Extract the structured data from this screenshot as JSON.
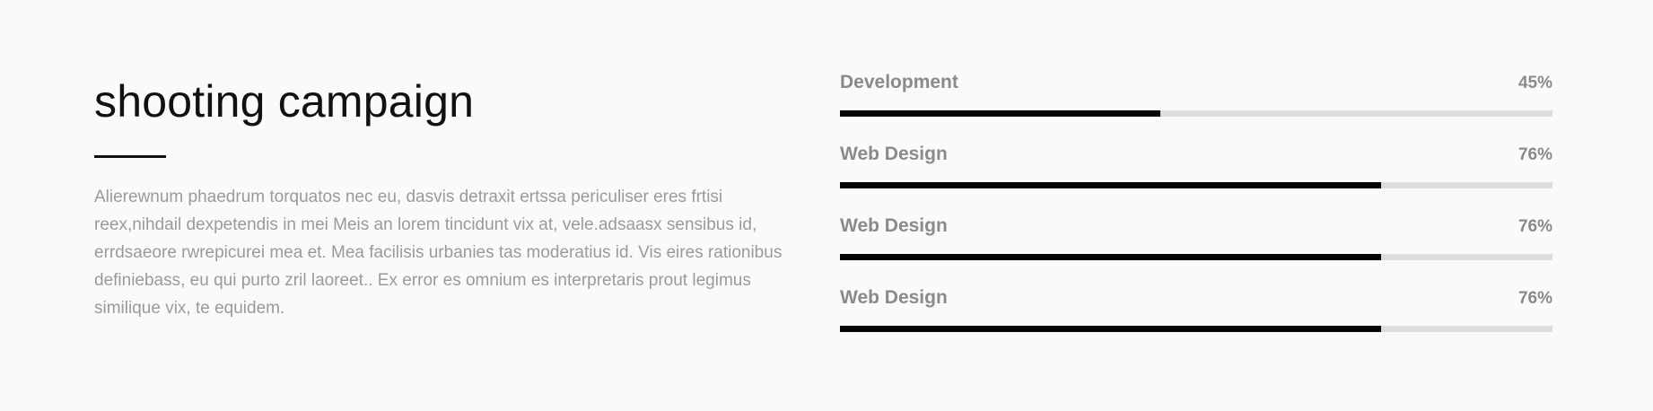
{
  "intro": {
    "title": "shooting campaign",
    "body": "Alierewnum phaedrum torquatos nec eu, dasvis detraxit ertssa periculiser eres frtisi reex,nihdail dexpetendis in mei Meis an lorem tincidunt vix at, vele.adsaasx sensibus id, errdsaeore rwrepicurei mea et. Mea facilisis urbanies tas moderatius id. Vis eires rationibus definiebass, eu qui purto zril laoreet.. Ex error es omnium es interpretaris prout legimus similique vix, te equidem."
  },
  "skills": [
    {
      "label": "Development",
      "value": "45%",
      "percent": 45
    },
    {
      "label": "Web Design",
      "value": "76%",
      "percent": 76
    },
    {
      "label": "Web Design",
      "value": "76%",
      "percent": 76
    },
    {
      "label": "Web Design",
      "value": "76%",
      "percent": 76
    }
  ]
}
